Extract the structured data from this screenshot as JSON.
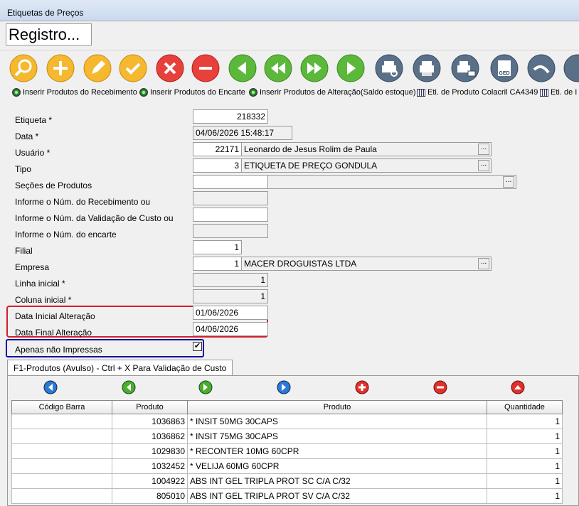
{
  "window": {
    "title": "Etiquetas de Preços"
  },
  "header": {
    "registro": "Registro..."
  },
  "links": [
    {
      "label": "Inserir Produtos do Recebimento"
    },
    {
      "label": "Inserir Produtos do Encarte"
    },
    {
      "label": "Inserir Produtos de Alteração(Saldo estoque)"
    },
    {
      "label": "Eti. de Produto Colacril CA4349"
    },
    {
      "label": "Eti. de I"
    }
  ],
  "form": {
    "etiqueta_label": "Etiqueta *",
    "etiqueta": "218332",
    "data_label": "Data *",
    "data": "04/06/2026 15:48:17",
    "usuario_label": "Usuário *",
    "usuario_code": "22171",
    "usuario_name": "Leonardo de Jesus Rolim de Paula",
    "tipo_label": "Tipo",
    "tipo_code": "3",
    "tipo_name": "ETIQUETA DE PREÇO GONDULA",
    "secoes_label": "Seções de Produtos",
    "recebimento_label": "Informe o Núm. do Recebimento ou",
    "validacao_label": "Informe o Núm. da Validação de Custo ou",
    "encarte_label": "Informe o Núm. do encarte",
    "filial_label": "Filial",
    "filial": "1",
    "empresa_label": "Empresa",
    "empresa_code": "1",
    "empresa_name": "MACER DROGUISTAS LTDA",
    "linha_label": "Linha inicial *",
    "linha": "1",
    "coluna_label": "Coluna inicial *",
    "coluna": "1",
    "data_inicial_label": "Data Inicial Alteração",
    "data_inicial": "01/06/2026",
    "data_final_label": "Data Final Alteração",
    "data_final": "04/06/2026",
    "apenas_label": "Apenas não Impressas",
    "apenas_checked": "✔"
  },
  "tab": {
    "label": "F1-Produtos (Avulso) - Ctrl + X Para Validação de Custo"
  },
  "table": {
    "headers": [
      "Código Barra",
      "Produto",
      "Produto",
      "Quantidade"
    ],
    "rows": [
      [
        "",
        "1036863",
        "* INSIT 50MG 30CAPS",
        "1"
      ],
      [
        "",
        "1036862",
        "* INSIT 75MG 30CAPS",
        "1"
      ],
      [
        "",
        "1029830",
        "* RECONTER 10MG 60CPR",
        "1"
      ],
      [
        "",
        "1032452",
        "* VELIJA 60MG 60CPR",
        "1"
      ],
      [
        "",
        "1004922",
        "ABS INT GEL TRIPLA PROT SC C/A C/32",
        "1"
      ],
      [
        "",
        "805010",
        "ABS INT GEL TRIPLA PROT SV C/A C/32",
        "1"
      ]
    ]
  },
  "icons": {
    "toolbar": [
      "search-icon",
      "add-icon",
      "edit-icon",
      "confirm-icon",
      "delete-icon",
      "remove-icon",
      "first-icon",
      "previous-icon",
      "next-icon",
      "last-icon",
      "print-preview-icon",
      "print-icon",
      "print-email-icon",
      "ged-icon",
      "back-icon",
      "more-icon"
    ]
  }
}
